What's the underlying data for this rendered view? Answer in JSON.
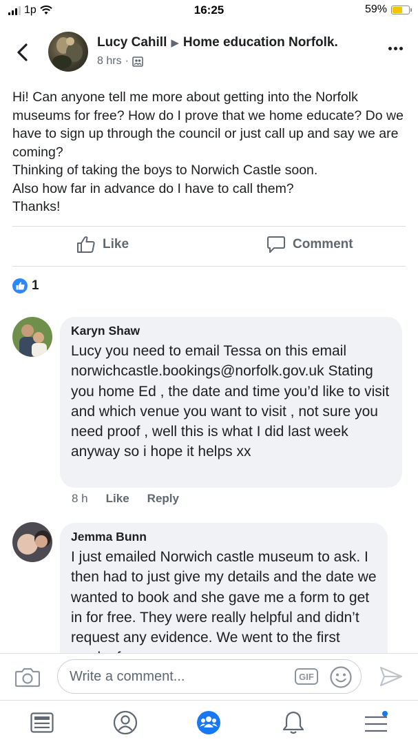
{
  "status_bar": {
    "carrier": "1p",
    "time": "16:25",
    "battery": "59%",
    "battery_level": 0.59
  },
  "post": {
    "author": "Lucy Cahill",
    "group": "Home education Norfolk.",
    "time": "8 hrs",
    "body": "Hi! Can anyone tell me more about getting into the Norfolk museums for free? How do I prove that we home educate? Do we have to sign up through the council or just call up and say we are coming?\nThinking of taking the boys to Norwich Castle soon.\nAlso how far in advance do I have to call them?\nThanks!",
    "like_label": "Like",
    "comment_label": "Comment",
    "reaction_count": "1"
  },
  "comments": [
    {
      "name": "Karyn Shaw",
      "text": "Lucy you need to email Tessa on this email norwichcastle.bookings@norfolk.gov.uk Stating you home Ed , the date and time you’d like to visit and which venue you want to visit , not sure you need proof , well this is what I did last week anyway so i hope it helps xx",
      "time": "8 h",
      "like_label": "Like",
      "reply_label": "Reply"
    },
    {
      "name": "Jemma Bunn",
      "text": "I just emailed Norwich castle museum to ask. I then had to just give my details and the date we wanted to book and she gave me a form to get in for free. They were really helpful and didn’t request any evidence. We went to the first week of"
    }
  ],
  "composer": {
    "placeholder": "Write a comment...",
    "gif_label": "GIF"
  },
  "icons": {
    "accent": "#1877f2",
    "nav": [
      "news-feed-icon",
      "profile-icon",
      "groups-icon",
      "notifications-icon",
      "menu-icon"
    ]
  }
}
